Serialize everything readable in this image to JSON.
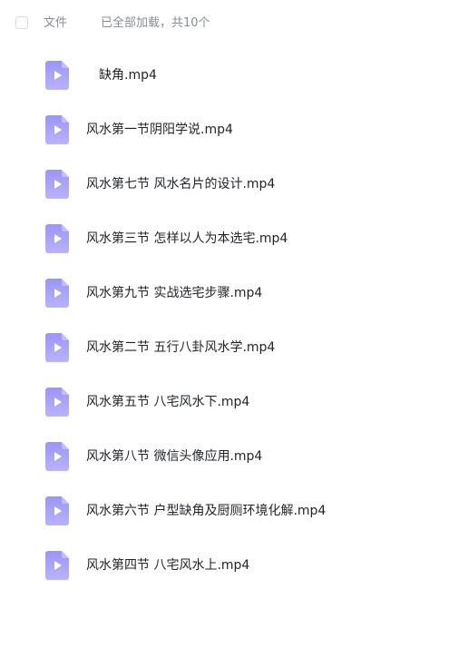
{
  "header": {
    "column_label": "文件",
    "status": "已全部加载，共10个"
  },
  "files": [
    {
      "name": "缺角.mp4"
    },
    {
      "name": "风水第一节阴阳学说.mp4"
    },
    {
      "name": "风水第七节 风水名片的设计.mp4"
    },
    {
      "name": "风水第三节 怎样以人为本选宅.mp4"
    },
    {
      "name": "风水第九节 实战选宅步骤.mp4"
    },
    {
      "name": "风水第二节 五行八卦风水学.mp4"
    },
    {
      "name": "风水第五节 八宅风水下.mp4"
    },
    {
      "name": "风水第八节 微信头像应用.mp4"
    },
    {
      "name": "风水第六节 户型缺角及厨厕环境化解.mp4"
    },
    {
      "name": "风水第四节 八宅风水上.mp4"
    }
  ],
  "colors": {
    "icon_top": "#9b95f7",
    "icon_bottom": "#b8b3fb",
    "text": "#1f2328",
    "muted": "#878c9c"
  },
  "icons": {
    "file": "video-file-icon"
  }
}
